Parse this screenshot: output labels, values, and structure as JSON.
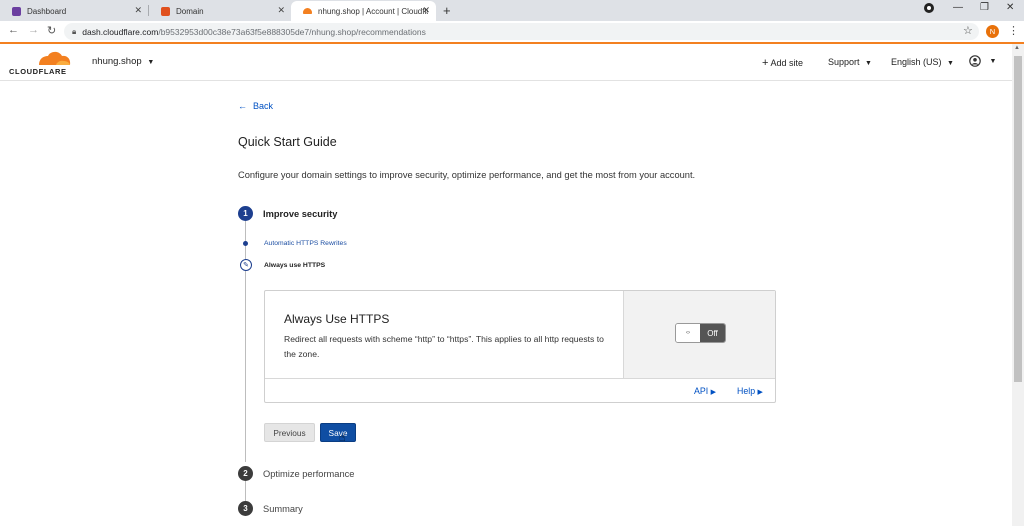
{
  "browser": {
    "tabs": [
      {
        "label": "Dashboard",
        "active": false
      },
      {
        "label": "Domain",
        "active": false
      },
      {
        "label": "nhung.shop | Account | Cloudfla",
        "active": true
      }
    ],
    "url_host": "dash.cloudflare.com",
    "url_path": "/b9532953d00c38e73a63f5e888305de7/nhung.shop/recommendations",
    "profile_initial": "N"
  },
  "header": {
    "logo_text": "CLOUDFLARE",
    "domain": "nhung.shop",
    "add_site": "Add site",
    "support": "Support",
    "language": "English (US)"
  },
  "main": {
    "back": "Back",
    "title": "Quick Start Guide",
    "description": "Configure your domain settings to improve security, optimize performance, and get the most from your account.",
    "steps": [
      {
        "number": "1",
        "label": "Improve security",
        "active": true
      },
      {
        "number": "2",
        "label": "Optimize performance",
        "active": false
      },
      {
        "number": "3",
        "label": "Summary",
        "active": false
      }
    ],
    "substeps": [
      {
        "label": "Automatic HTTPS Rewrites"
      },
      {
        "label": "Always use HTTPS"
      }
    ],
    "card": {
      "title": "Always Use HTTPS",
      "description": "Redirect all requests with scheme “http” to “https”. This applies to all http requests to the zone.",
      "toggle_knob": "‹›",
      "toggle_state": "Off",
      "api_link": "API",
      "help_link": "Help"
    },
    "buttons": {
      "previous": "Previous",
      "save": "Save"
    }
  },
  "colors": {
    "accent": "#f38020",
    "link": "#0051c3",
    "step_active": "#1d3f8f",
    "step_inactive": "#3c3c3c",
    "save_button": "#0f4ea3"
  }
}
